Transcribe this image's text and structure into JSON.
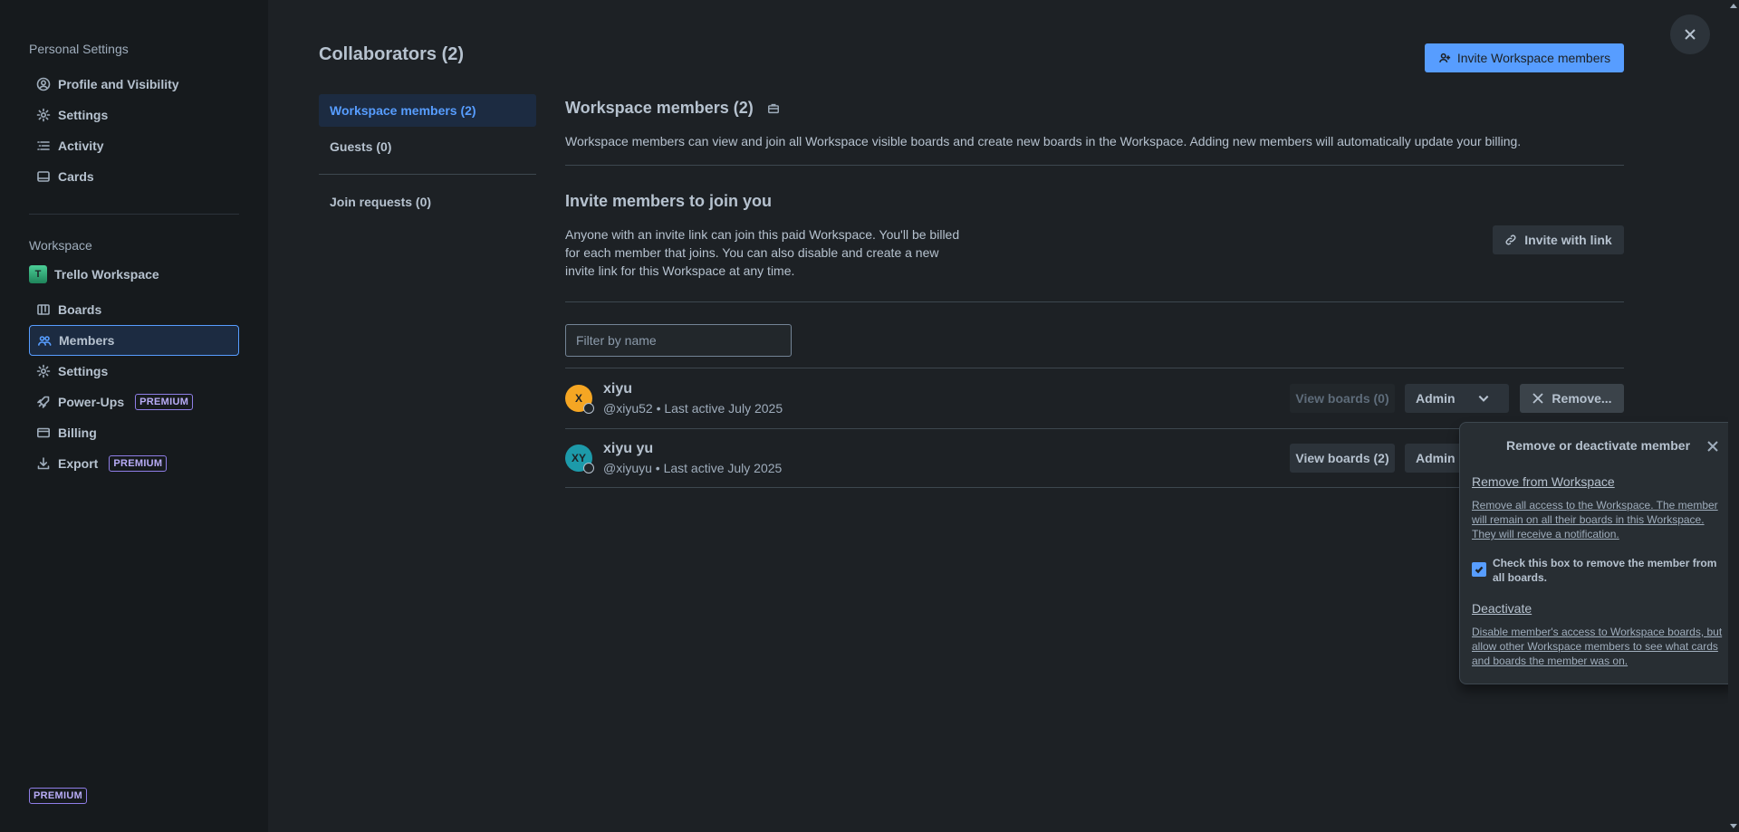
{
  "sidebar": {
    "personal_heading": "Personal Settings",
    "personal_items": [
      {
        "label": "Profile and Visibility"
      },
      {
        "label": "Settings"
      },
      {
        "label": "Activity"
      },
      {
        "label": "Cards"
      }
    ],
    "workspace_heading": "Workspace",
    "workspace_name": "Trello Workspace",
    "workspace_initial": "T",
    "workspace_items": [
      {
        "label": "Boards"
      },
      {
        "label": "Members"
      },
      {
        "label": "Settings"
      },
      {
        "label": "Power-Ups",
        "badge": "PREMIUM"
      },
      {
        "label": "Billing"
      },
      {
        "label": "Export",
        "badge": "PREMIUM"
      }
    ],
    "bottom_badge": "PREMIUM"
  },
  "main": {
    "title": "Collaborators (2)",
    "invite_button": "Invite Workspace members",
    "tabs": [
      {
        "label": "Workspace members (2)"
      },
      {
        "label": "Guests (0)"
      },
      {
        "label": "Join requests (0)"
      }
    ],
    "members_section": {
      "title": "Workspace members (2)",
      "description": "Workspace members can view and join all Workspace visible boards and create new boards in the Workspace. Adding new members will automatically update your billing."
    },
    "invite_section": {
      "title": "Invite members to join you",
      "description_lines": [
        "Anyone with an invite link can join this paid Workspace. You'll be billed",
        "for each member that joins. You can also disable and create a new",
        "invite link for this Workspace at any time."
      ],
      "invite_link_button": "Invite with link"
    },
    "filter": {
      "placeholder": "Filter by name",
      "value": ""
    },
    "members": [
      {
        "initials": "X",
        "name": "xiyu",
        "meta": "@xiyu52 • Last active July 2025",
        "view_boards": "View boards (0)",
        "role": "Admin",
        "action": "Remove...",
        "avatar_color": "#f5a623"
      },
      {
        "initials": "XY",
        "name": "xiyu yu",
        "meta": "@xiyuyu • Last active July 2025",
        "view_boards": "View boards (2)",
        "role": "Admin",
        "avatar_color": "#1d9aaa"
      }
    ]
  },
  "popover": {
    "title": "Remove or deactivate member",
    "remove_link": "Remove from Workspace",
    "remove_desc_lines": [
      "Remove all access to the Workspace. The member",
      "will remain on all their boards in this Workspace.",
      "They will receive a notification."
    ],
    "checkbox_label_lines": [
      "Check this box to remove the member from",
      "all boards."
    ],
    "checkbox_checked": true,
    "deactivate_link": "Deactivate",
    "deactivate_desc_lines": [
      "Disable member's access to Workspace boards, but",
      "allow other Workspace members to see what cards",
      "and boards the member was on."
    ]
  },
  "colors": {
    "accent": "#579dff",
    "background": "#1d2125",
    "sidebar": "#161a1d",
    "premium": "#8f7ee7"
  }
}
